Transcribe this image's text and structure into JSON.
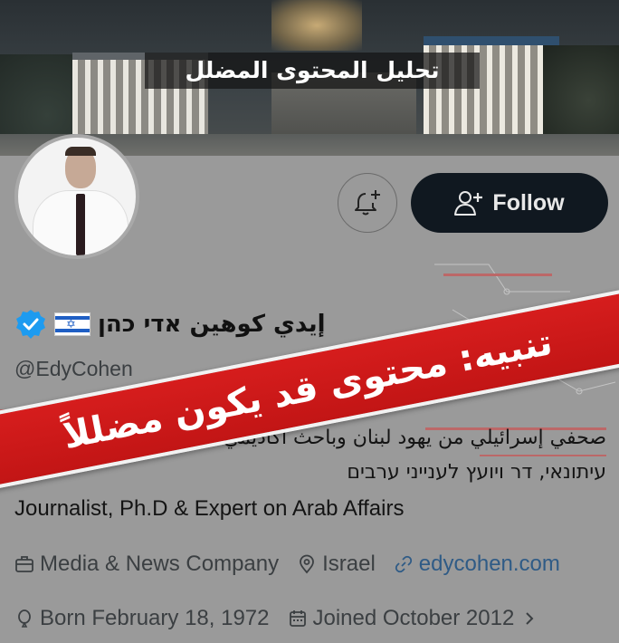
{
  "banner": {
    "caption": "تحليل المحتوى المضلل"
  },
  "actions": {
    "notify_icon": "bell-plus-icon",
    "follow_label": "Follow",
    "follow_icon": "person-plus-icon"
  },
  "profile": {
    "display_name": "إيدي كوهين אדי כהן",
    "verified": true,
    "flag": "israel-flag",
    "handle": "@EdyCohen",
    "bio_arabic": "صحفي إسرائيلي من يهود لبنان وباحث أكاديمي",
    "bio_hebrew": "עיתונאי, דר ויועץ לענייני ערבים",
    "bio_english": "Journalist, Ph.D & Expert on Arab Affairs",
    "category": "Media & News Company",
    "location": "Israel",
    "website": "edycohen.com",
    "born": "Born February 18, 1972",
    "joined": "Joined October 2012"
  },
  "warning": {
    "text": "تنبيه: محتوى قد يكون مضللاً",
    "color": "#d61d1d"
  },
  "colors": {
    "follow_bg": "#101820",
    "verified": "#1d9bf0",
    "link": "#2f5b86"
  }
}
